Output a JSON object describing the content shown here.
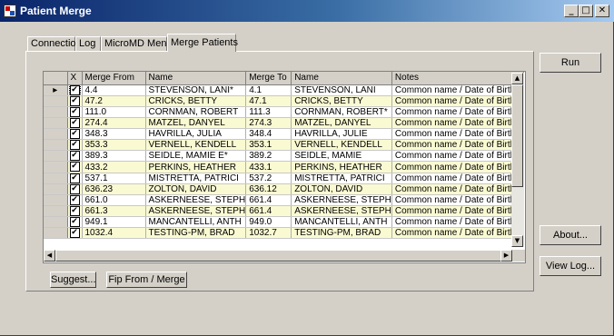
{
  "window": {
    "title": "Patient Merge",
    "min": "_",
    "max": "□",
    "close": "✕"
  },
  "tabs": [
    "Connection",
    "Log",
    "MicroMD Menu",
    "Merge Patients"
  ],
  "columns": [
    "X",
    "Merge From",
    "Name",
    "Merge To",
    "Name",
    "Notes"
  ],
  "rows": [
    {
      "checked": "✔",
      "from": "4.4",
      "from_name": "STEVENSON, LANI*",
      "to": "4.1",
      "to_name": "STEVENSON, LANI",
      "notes": "Common name / Date of Birth"
    },
    {
      "checked": "✔",
      "from": "47.2",
      "from_name": "CRICKS, BETTY",
      "to": "47.1",
      "to_name": "CRICKS, BETTY",
      "notes": "Common name / Date of Birth"
    },
    {
      "checked": "✔",
      "from": "111.0",
      "from_name": "CORNMAN, ROBERT",
      "to": "111.3",
      "to_name": "CORNMAN, ROBERT*",
      "notes": "Common name / Date of Birth"
    },
    {
      "checked": "✔",
      "from": "274.4",
      "from_name": "MATZEL, DANYEL",
      "to": "274.3",
      "to_name": "MATZEL, DANYEL",
      "notes": "Common name / Date of Birth"
    },
    {
      "checked": "✔",
      "from": "348.3",
      "from_name": "HAVRILLA, JULIA",
      "to": "348.4",
      "to_name": "HAVRILLA, JULIE",
      "notes": "Common name / Date of Birth"
    },
    {
      "checked": "✔",
      "from": "353.3",
      "from_name": "VERNELL, KENDELL",
      "to": "353.1",
      "to_name": "VERNELL, KENDELL",
      "notes": "Common name / Date of Birth"
    },
    {
      "checked": "✔",
      "from": "389.3",
      "from_name": "SEIDLE, MAMIE E*",
      "to": "389.2",
      "to_name": "SEIDLE, MAMIE",
      "notes": "Common name / Date of Birth"
    },
    {
      "checked": "✔",
      "from": "433.2",
      "from_name": "PERKINS, HEATHER",
      "to": "433.1",
      "to_name": "PERKINS, HEATHER",
      "notes": "Common name / Date of Birth"
    },
    {
      "checked": "✔",
      "from": "537.1",
      "from_name": "MISTRETTA, PATRICI",
      "to": "537.2",
      "to_name": "MISTRETTA, PATRICI",
      "notes": "Common name / Date of Birth"
    },
    {
      "checked": "✔",
      "from": "636.23",
      "from_name": "ZOLTON, DAVID",
      "to": "636.12",
      "to_name": "ZOLTON, DAVID",
      "notes": "Common name / Date of Birth"
    },
    {
      "checked": "✔",
      "from": "661.0",
      "from_name": "ASKERNEESE, STEPH",
      "to": "661.4",
      "to_name": "ASKERNEESE, STEPH",
      "notes": "Common name / Date of Birth"
    },
    {
      "checked": "✔",
      "from": "661.3",
      "from_name": "ASKERNEESE, STEPH",
      "to": "661.4",
      "to_name": "ASKERNEESE, STEPH",
      "notes": "Common name / Date of Birth"
    },
    {
      "checked": "✔",
      "from": "949.1",
      "from_name": "MANCANTELLI, ANTH",
      "to": "949.0",
      "to_name": "MANCANTELLI, ANTH",
      "notes": "Common name / Date of Birth"
    },
    {
      "checked": "✔",
      "from": "1032.4",
      "from_name": "TESTING-PM, BRAD",
      "to": "1032.7",
      "to_name": "TESTING-PM, BRAD",
      "notes": "Common name / Date of Birth"
    }
  ],
  "current_row_marker": "▸",
  "buttons": {
    "run": "Run",
    "about": "About...",
    "view_log": "View Log...",
    "suggest": "Suggest...",
    "flip": "Fip From / Merge"
  },
  "scroll": {
    "up": "▲",
    "down": "▼",
    "left": "◀",
    "right": "▶"
  }
}
